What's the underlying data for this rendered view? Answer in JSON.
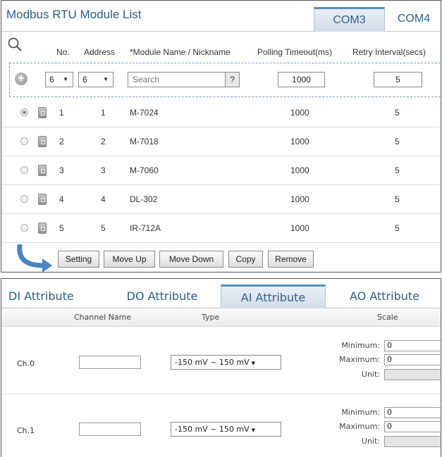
{
  "module_list": {
    "title": "Modbus RTU Module List",
    "tabs": [
      {
        "label": "COM3",
        "active": true
      },
      {
        "label": "COM4",
        "active": false
      }
    ],
    "columns": {
      "no": "No.",
      "address": "Address",
      "name": "*Module Name / Nickname",
      "polling": "Polling Timeout(ms)",
      "retry": "Retry Interval(secs)"
    },
    "add_row": {
      "no_value": "6",
      "address_value": "6",
      "search_placeholder": "Search",
      "help_label": "?",
      "polling_value": "1000",
      "retry_value": "5"
    },
    "rows": [
      {
        "no": "1",
        "address": "1",
        "name": "M-7024",
        "polling": "1000",
        "retry": "5",
        "selected": true
      },
      {
        "no": "2",
        "address": "2",
        "name": "M-7018",
        "polling": "1000",
        "retry": "5",
        "selected": false
      },
      {
        "no": "3",
        "address": "3",
        "name": "M-7060",
        "polling": "1000",
        "retry": "5",
        "selected": false
      },
      {
        "no": "4",
        "address": "4",
        "name": "DL-302",
        "polling": "1000",
        "retry": "5",
        "selected": false
      },
      {
        "no": "5",
        "address": "5",
        "name": "IR-712A",
        "polling": "1000",
        "retry": "5",
        "selected": false
      }
    ],
    "actions": {
      "setting": "Setting",
      "move_up": "Move Up",
      "move_down": "Move Down",
      "copy": "Copy",
      "remove": "Remove"
    }
  },
  "attributes": {
    "tabs": [
      {
        "label": "DI Attribute",
        "active": false
      },
      {
        "label": "DO Attribute",
        "active": false
      },
      {
        "label": "AI Attribute",
        "active": true
      },
      {
        "label": "AO Attribute",
        "active": false
      }
    ],
    "columns": {
      "channel_name": "Channel Name",
      "type": "Type",
      "scale": "Scale"
    },
    "scale_labels": {
      "minimum": "Minimum:",
      "maximum": "Maximum:",
      "unit": "Unit:"
    },
    "channels": [
      {
        "label": "Ch.0",
        "name": "",
        "type": "-150 mV ~ 150 mV",
        "minimum": "0",
        "maximum": "0",
        "unit": ""
      },
      {
        "label": "Ch.1",
        "name": "",
        "type": "-150 mV ~ 150 mV",
        "minimum": "0",
        "maximum": "0",
        "unit": ""
      }
    ]
  },
  "colors": {
    "accent": "#2d5f8a",
    "active_tab_border": "#5b8fbf"
  },
  "icons": {
    "search": "magnifier-icon",
    "add": "plus-circle-icon",
    "module": "module-icon",
    "arrow": "curved-arrow-icon",
    "dropdown": "triangle-down-icon"
  }
}
